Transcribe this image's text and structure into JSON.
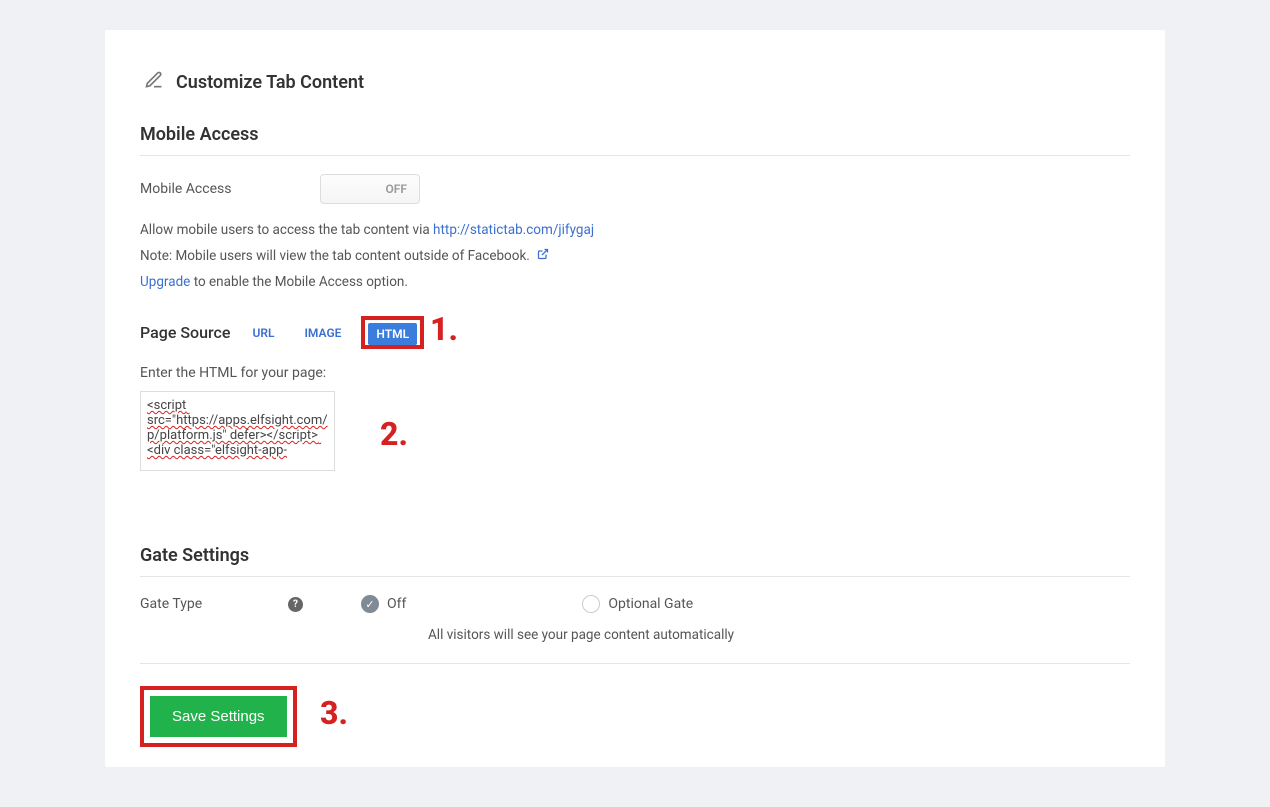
{
  "title": "Customize Tab Content",
  "sections": {
    "mobile": {
      "header": "Mobile Access",
      "label": "Mobile Access",
      "toggle": "OFF",
      "helper1_prefix": "Allow mobile users to access the tab content via ",
      "helper1_link": "http://statictab.com/jifygaj",
      "helper2": "Note: Mobile users will view the tab content outside of Facebook.",
      "upgrade_link": "Upgrade",
      "upgrade_suffix": " to enable the Mobile Access option."
    },
    "page_source": {
      "label": "Page Source",
      "tabs": {
        "url": "URL",
        "image": "IMAGE",
        "html": "HTML"
      },
      "instruction": "Enter the HTML for your page:",
      "textarea_value": "<script src=\"https://apps.elfsight.com/p/platform.js\" defer></script> <div class=\"elfsight-app-"
    },
    "gate": {
      "header": "Gate Settings",
      "label": "Gate Type",
      "off_label": "Off",
      "optional_label": "Optional Gate",
      "description": "All visitors will see your page content automatically"
    }
  },
  "save_button": "Save Settings",
  "annotations": {
    "n1": "1.",
    "n2": "2.",
    "n3": "3."
  }
}
